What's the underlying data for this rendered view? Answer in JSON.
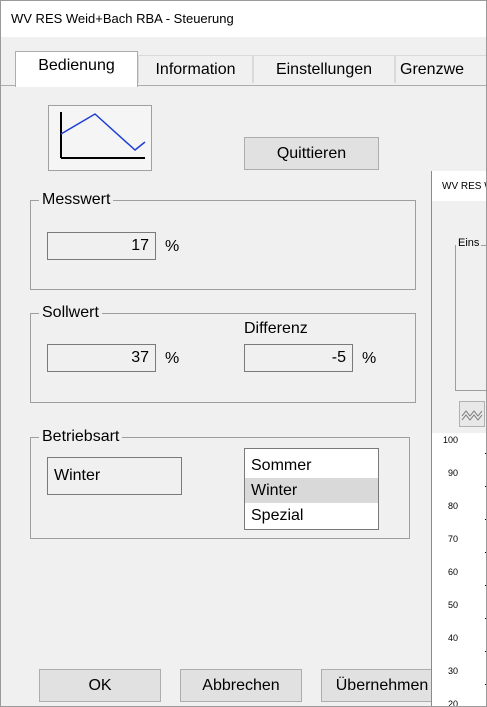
{
  "window": {
    "title": "WV RES Weid+Bach RBA - Steuerung"
  },
  "tabs": [
    {
      "label": "Bedienung"
    },
    {
      "label": "Information"
    },
    {
      "label": "Einstellungen"
    },
    {
      "label": "Grenzwe"
    }
  ],
  "buttons": {
    "quittieren": "Quittieren",
    "ok": "OK",
    "abbrechen": "Abbrechen",
    "uebernehmen": "Übernehmen"
  },
  "messwert": {
    "legend": "Messwert",
    "value": "17",
    "unit": "%"
  },
  "sollwert": {
    "legend": "Sollwert",
    "value": "37",
    "unit": "%",
    "differenz_label": "Differenz",
    "differenz_value": "-5",
    "differenz_unit": "%"
  },
  "betriebsart": {
    "legend": "Betriebsart",
    "current": "Winter",
    "options": [
      "Sommer",
      "Winter",
      "Spezial"
    ],
    "selected": "Winter"
  },
  "overlay_window": {
    "title": "WV RES W",
    "group_label": "Eins",
    "axis_ticks": [
      "100",
      "90",
      "80",
      "70",
      "60",
      "50",
      "40",
      "30",
      "20"
    ]
  },
  "colors": {
    "accent_line": "#1f3fd6",
    "window_bg": "#f0f0f0"
  },
  "icons": {
    "graph_button": "trend-graph-icon",
    "tab_scroll": "tab-scroll-arrows",
    "overlay_chart_button": "waveform-icon"
  }
}
